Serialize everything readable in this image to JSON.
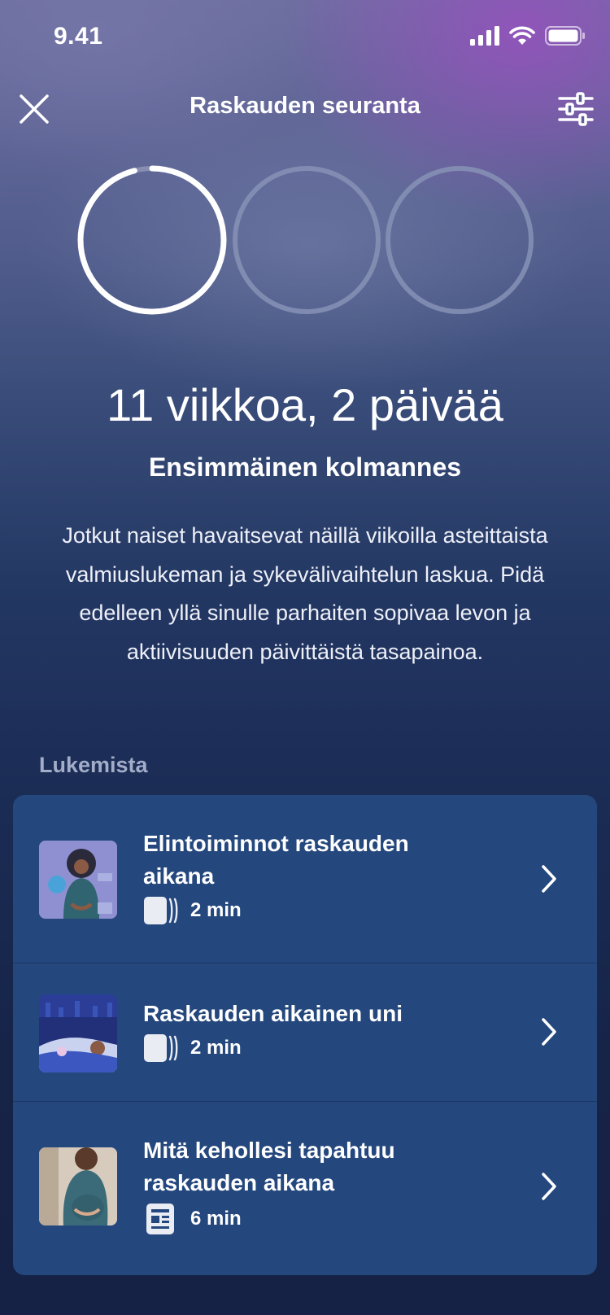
{
  "status_bar": {
    "time": "9.41"
  },
  "header": {
    "title": "Raskauden seuranta"
  },
  "progress": {
    "trimesters": [
      {
        "fraction": 0.96
      },
      {
        "fraction": 0
      },
      {
        "fraction": 0
      }
    ]
  },
  "summary": {
    "weeks": "11 viikkoa, 2 päivää",
    "trimester": "Ensimmäinen kolmannes",
    "description": "Jotkut naiset havaitsevat näillä viikoilla asteittaista valmiuslukeman ja sykevälivaihtelun laskua. Pidä edelleen yllä sinulle parhaiten sopivaa levon ja aktiivisuuden päivittäistä tasapainoa."
  },
  "reading": {
    "section_label": "Lukemista",
    "items": [
      {
        "title": "Elintoiminnot raskauden aikana",
        "duration": "2 min",
        "type_icon": "story-icon"
      },
      {
        "title": "Raskauden aikainen uni",
        "duration": "2 min",
        "type_icon": "story-icon"
      },
      {
        "title": "Mitä kehollesi tapahtuu raskauden aikana",
        "duration": "6 min",
        "type_icon": "article-icon"
      }
    ]
  },
  "colors": {
    "card": "#24477d",
    "ring_active": "#ffffff",
    "ring_inactive": "#8a95b8"
  }
}
